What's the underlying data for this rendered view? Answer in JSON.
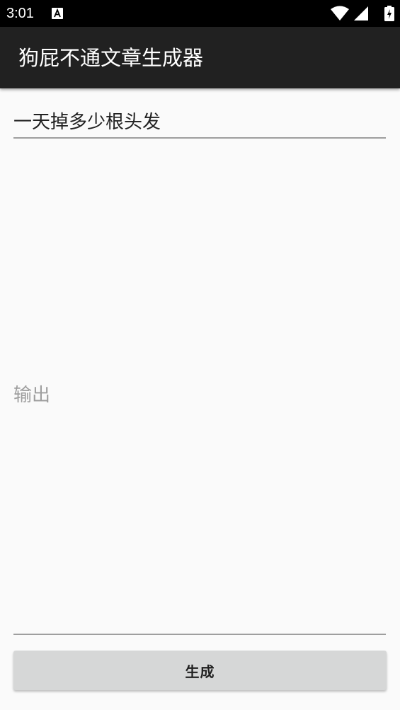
{
  "status_bar": {
    "time": "3:01",
    "notification_icon": "font-a-icon",
    "icons": [
      "wifi-icon",
      "signal-icon",
      "battery-charging-icon"
    ]
  },
  "app_bar": {
    "title": "狗屁不通文章生成器"
  },
  "topic_input": {
    "value": "一天掉多少根头发"
  },
  "output": {
    "placeholder": "输出"
  },
  "generate_button": {
    "label": "生成"
  },
  "colors": {
    "status_bar": "#000000",
    "app_bar": "#212121",
    "background": "#fafafa",
    "button": "#d6d7d7",
    "underline": "#9e9e9e",
    "hint_text": "#9e9e9e"
  }
}
